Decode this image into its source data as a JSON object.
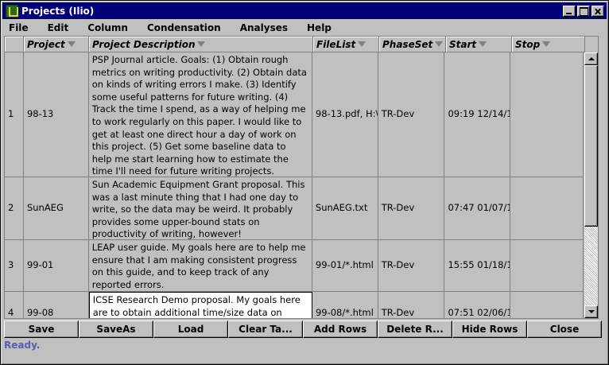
{
  "window": {
    "title": "Projects (Ilio)"
  },
  "menu": [
    "File",
    "Edit",
    "Column",
    "Condensation",
    "Analyses",
    "Help"
  ],
  "columns": [
    {
      "label": "Project"
    },
    {
      "label": "Project Description"
    },
    {
      "label": "FileList"
    },
    {
      "label": "PhaseSet"
    },
    {
      "label": "Start"
    },
    {
      "label": "Stop"
    }
  ],
  "rows": [
    {
      "num": "1",
      "project": "98-13",
      "description": "PSP Journal article.   Goals: (1) Obtain rough metrics on writing productivity. (2) Obtain data on kinds of writing errors I make. (3) Identify some useful patterns for future writing. (4) Track the time I spend, as a way of helping me to work regularly on this paper.  I would like to get at least one direct hour a day of work on this project. (5) Get some baseline data to help me start learning how to estimate the time I'll need for future writing projects.",
      "filelist": "98-13.pdf, H:\\",
      "phaseset": "TR-Dev",
      "start": "09:19 12/14/1",
      "stop": ""
    },
    {
      "num": "2",
      "project": "SunAEG",
      "description": "Sun Academic Equipment Grant proposal. This was a last minute thing that I had one day to write, so the data may be weird. It probably  provides some upper-bound stats on  productivity of writing, however!",
      "filelist": "SunAEG.txt",
      "phaseset": "TR-Dev",
      "start": "07:47 01/07/1",
      "stop": ""
    },
    {
      "num": "3",
      "project": "99-01",
      "description": "LEAP user guide.  My goals here are to help me ensure that I am making consistent progress on this guide, and to keep track of any reported errors.",
      "filelist": "99-01/*.html",
      "phaseset": "TR-Dev",
      "start": "15:55 01/18/1",
      "stop": ""
    },
    {
      "num": "4",
      "project": "99-08",
      "description": "ICSE Research Demo proposal.  My goals here are to obtain additional time/size data on technical",
      "filelist": "99-08/*.html",
      "phaseset": "TR-Dev",
      "start": "07:51 02/06/1",
      "stop": ""
    }
  ],
  "buttons": [
    "Save",
    "SaveAs",
    "Load",
    "Clear Ta...",
    "Add Rows",
    "Delete R...",
    "Hide Rows",
    "Close"
  ],
  "status": "Ready.",
  "icons": {
    "app": "leap-app-icon",
    "sort": "sort-arrow-icon"
  }
}
